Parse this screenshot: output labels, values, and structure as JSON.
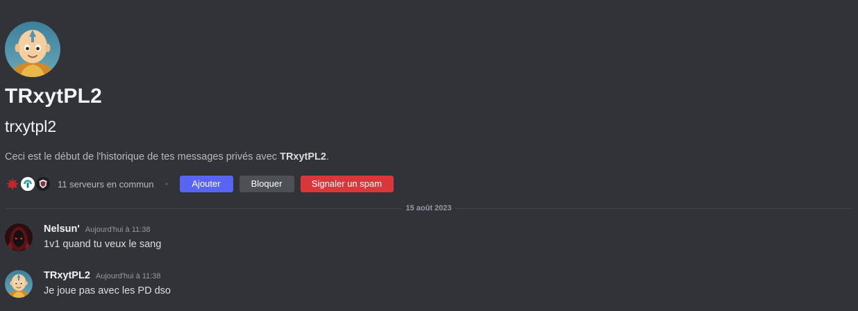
{
  "colors": {
    "background": "#313338",
    "primary": "#5865f2",
    "secondary": "#4e5058",
    "danger": "#da373c"
  },
  "intro": {
    "avatar_icon": "user-avatar-aang",
    "display_name": "TRxytPL2",
    "username": "trxytpl2",
    "description_prefix": "Ceci est le début de l'historique de tes messages privés avec ",
    "description_name": "TRxytPL2",
    "description_suffix": "."
  },
  "mutual": {
    "server_icons": [
      "server-icon-red-maple",
      "server-icon-teal-logo",
      "server-icon-dark-shield"
    ],
    "text": "11 serveurs en commun"
  },
  "actions": {
    "add_label": "Ajouter",
    "block_label": "Bloquer",
    "spam_label": "Signaler un spam"
  },
  "divider": {
    "date": "15 août 2023"
  },
  "messages": [
    {
      "author": "Nelsun'",
      "timestamp": "Aujourd'hui à 11:38",
      "content": "1v1 quand tu veux le sang",
      "avatar_icon": "user-avatar-dark-hood"
    },
    {
      "author": "TRxytPL2",
      "timestamp": "Aujourd'hui à 11:38",
      "content": "Je joue pas avec les PD dso",
      "avatar_icon": "user-avatar-aang"
    }
  ]
}
